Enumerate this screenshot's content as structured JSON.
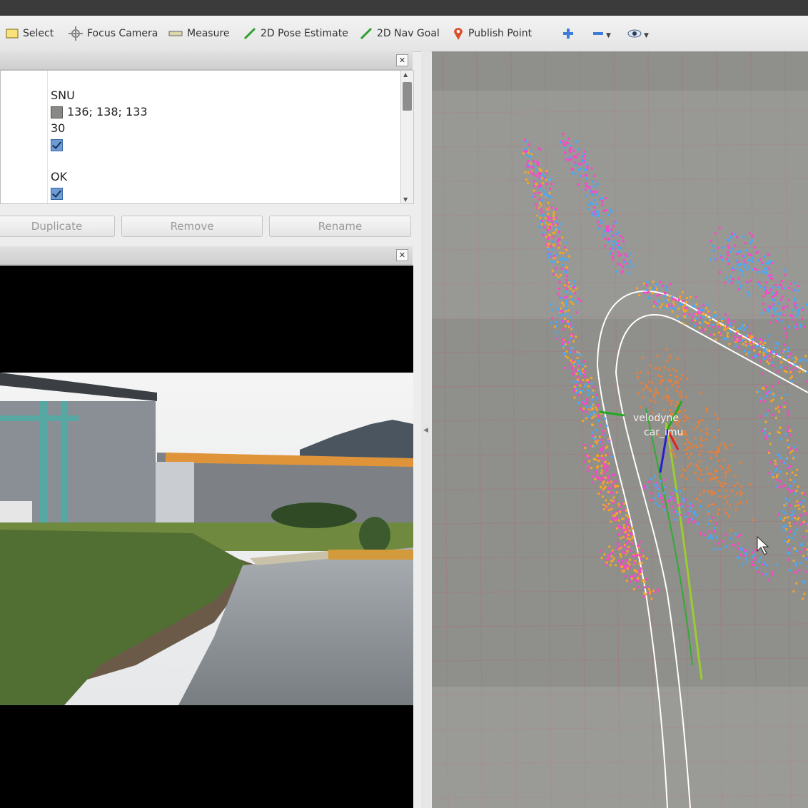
{
  "toolbar": {
    "select_label": "Select",
    "focus_camera_label": "Focus Camera",
    "measure_label": "Measure",
    "pose_estimate_label": "2D Pose Estimate",
    "nav_goal_label": "2D Nav Goal",
    "publish_point_label": "Publish Point"
  },
  "properties": {
    "values": {
      "name": "SNU",
      "color": "136; 138; 133",
      "number": "30",
      "status": "OK"
    },
    "buttons": {
      "duplicate": "Duplicate",
      "remove": "Remove",
      "rename": "Rename"
    }
  },
  "view3d": {
    "frames": {
      "velodyne": "velodyne",
      "car_imu": "car_imu"
    }
  },
  "colors": {
    "grid": "#a4787a",
    "point_cloud_near": "#f5a623",
    "point_cloud_mid": "#ff44cc",
    "point_cloud_far": "#44aaff",
    "path": "#ffffff"
  }
}
